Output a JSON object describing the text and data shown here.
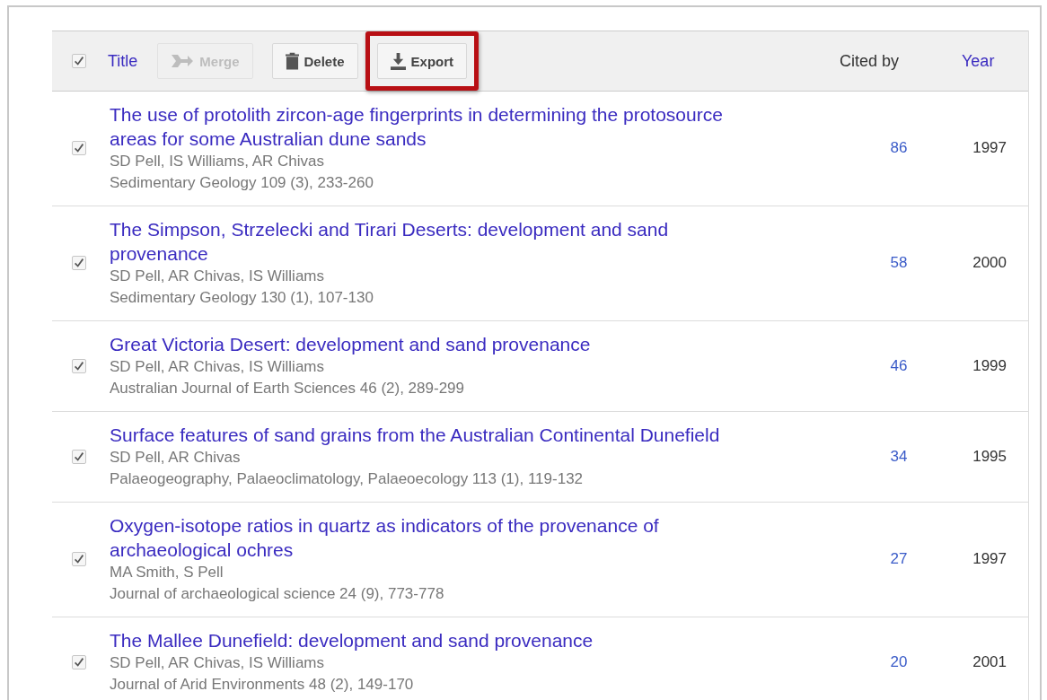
{
  "header": {
    "select_all": {
      "checked": true
    },
    "title_label": "Title",
    "buttons": [
      {
        "kind": "merge",
        "label": "Merge",
        "disabled": true,
        "highlighted": false
      },
      {
        "kind": "delete",
        "label": "Delete",
        "disabled": false,
        "highlighted": false
      },
      {
        "kind": "export",
        "label": "Export",
        "disabled": false,
        "highlighted": true
      }
    ],
    "cited_by_label": "Cited by",
    "year_label": "Year"
  },
  "articles": [
    {
      "checked": true,
      "title": "The use of protolith zircon-age fingerprints in determining the protosource areas for some Australian dune sands",
      "authors": "SD Pell, IS Williams, AR Chivas",
      "source": "Sedimentary Geology 109 (3), 233-260",
      "cited_by": "86",
      "year": "1997"
    },
    {
      "checked": true,
      "title": "The Simpson, Strzelecki and Tirari Deserts: development and sand provenance",
      "authors": "SD Pell, AR Chivas, IS Williams",
      "source": "Sedimentary Geology 130 (1), 107-130",
      "cited_by": "58",
      "year": "2000"
    },
    {
      "checked": true,
      "title": "Great Victoria Desert: development and sand provenance",
      "authors": "SD Pell, AR Chivas, IS Williams",
      "source": "Australian Journal of Earth Sciences 46 (2), 289-299",
      "cited_by": "46",
      "year": "1999"
    },
    {
      "checked": true,
      "title": "Surface features of sand grains from the Australian Continental Dunefield",
      "authors": "SD Pell, AR Chivas",
      "source": "Palaeogeography, Palaeoclimatology, Palaeoecology 113 (1), 119-132",
      "cited_by": "34",
      "year": "1995"
    },
    {
      "checked": true,
      "title": "Oxygen-isotope ratios in quartz as indicators of the provenance of archaeological ochres",
      "authors": "MA Smith, S Pell",
      "source": "Journal of archaeological science 24 (9), 773-778",
      "cited_by": "27",
      "year": "1997"
    },
    {
      "checked": true,
      "title": "The Mallee Dunefield: development and sand provenance",
      "authors": "SD Pell, AR Chivas, IS Williams",
      "source": "Journal of Arid Environments 48 (2), 149-170",
      "cited_by": "20",
      "year": "2001"
    }
  ]
}
